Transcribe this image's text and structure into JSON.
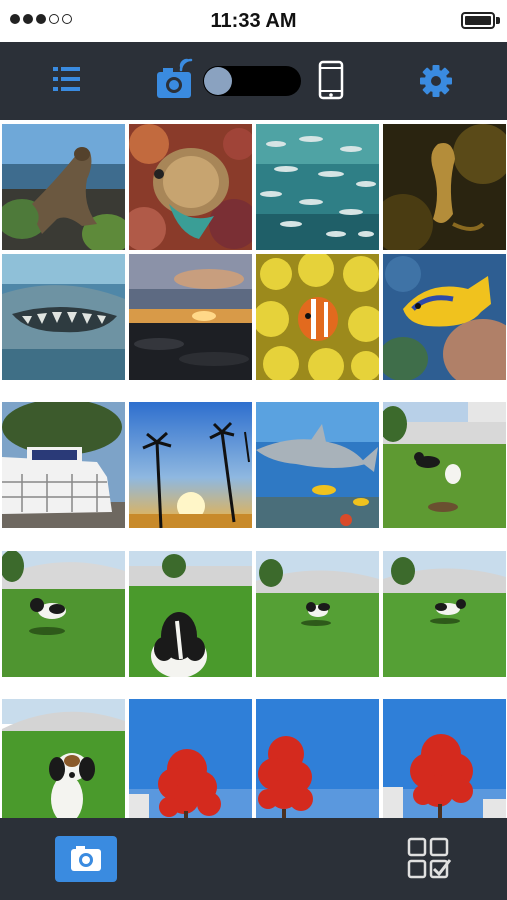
{
  "status_bar": {
    "time": "11:33 AM",
    "signal_dots_filled": 3,
    "signal_dots_total": 5,
    "battery_level": 1.0
  },
  "toolbar": {
    "icons": [
      "list-icon",
      "camera-remote-icon",
      "toggle-switch",
      "phone-icon",
      "gear-icon"
    ],
    "toggle_on": false,
    "accent_color": "#3a8be0"
  },
  "gallery": {
    "photos": [
      "sea-lion-rocks",
      "angelfish-coral",
      "fish-school",
      "seahorse",
      "shark-mouth",
      "sunset-coast",
      "clownfish-anemone",
      "blue-angelfish",
      "dive-boat",
      "palm-sunset",
      "shark-reef",
      "dog-frisbee",
      "dog-yard-1",
      "dog-closeup",
      "dog-yard-2",
      "dog-yard-3",
      "dog-sitting",
      "red-tree-1",
      "red-tree-2",
      "red-tree-3"
    ]
  },
  "bottom_bar": {
    "icons": [
      "camera-button-icon",
      "select-grid-icon"
    ]
  }
}
